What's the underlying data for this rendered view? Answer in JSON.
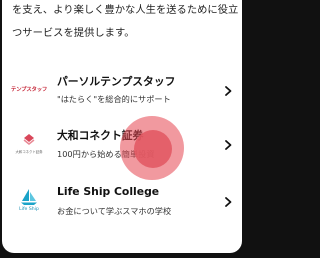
{
  "intro_text": "を支え、より楽しく豊かな人生を送るために役立つサービスを提供します。",
  "services": [
    {
      "name": "パーソルテンプスタッフ",
      "description": "\"はたらく\"を総合的にサポート",
      "logo_text": "テンプスタッフ",
      "logo_icon": "tempstaff-logo",
      "accent": "#c6283a"
    },
    {
      "name": "大和コネクト証券",
      "description": "100円から始める簡単投資",
      "logo_text": "大和コネクト証券",
      "logo_icon": "daiwa-connect-logo",
      "accent": "#d9475a"
    },
    {
      "name": "Life Ship College",
      "description": "お金について学ぶスマホの学校",
      "logo_text": "Life Ship",
      "logo_icon": "life-ship-logo",
      "accent": "#1aa3c8"
    }
  ],
  "tap_indicator_color": "#e5646f"
}
